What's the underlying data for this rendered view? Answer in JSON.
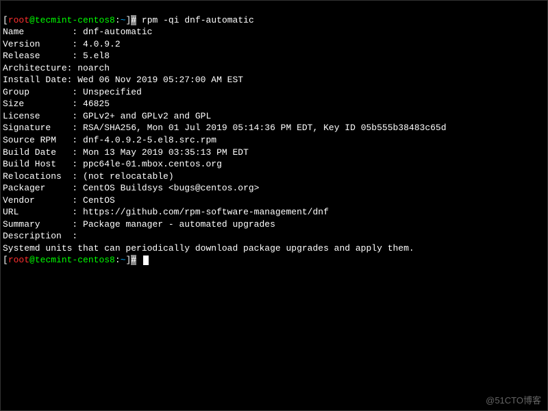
{
  "prompt": {
    "bracket_open": "[",
    "user": "root",
    "at": "@",
    "host": "tecmint-centos8",
    "colon": ":",
    "path": "~",
    "bracket_close": "]",
    "hash": "#"
  },
  "command": " rpm -qi dnf-automatic",
  "fields": {
    "name": {
      "label": "Name        ",
      "sep": " : ",
      "value": "dnf-automatic"
    },
    "version": {
      "label": "Version     ",
      "sep": " : ",
      "value": "4.0.9.2"
    },
    "release": {
      "label": "Release     ",
      "sep": " : ",
      "value": "5.el8"
    },
    "arch": {
      "label": "Architecture",
      "sep": ": ",
      "value": "noarch"
    },
    "install": {
      "label": "Install Date",
      "sep": ": ",
      "value": "Wed 06 Nov 2019 05:27:00 AM EST"
    },
    "group": {
      "label": "Group       ",
      "sep": " : ",
      "value": "Unspecified"
    },
    "size": {
      "label": "Size        ",
      "sep": " : ",
      "value": "46825"
    },
    "license": {
      "label": "License     ",
      "sep": " : ",
      "value": "GPLv2+ and GPLv2 and GPL"
    },
    "signature": {
      "label": "Signature   ",
      "sep": " : ",
      "value": "RSA/SHA256, Mon 01 Jul 2019 05:14:36 PM EDT, Key ID 05b555b38483c65d"
    },
    "sourcerpm": {
      "label": "Source RPM  ",
      "sep": " : ",
      "value": "dnf-4.0.9.2-5.el8.src.rpm"
    },
    "builddate": {
      "label": "Build Date  ",
      "sep": " : ",
      "value": "Mon 13 May 2019 03:35:13 PM EDT"
    },
    "buildhost": {
      "label": "Build Host  ",
      "sep": " : ",
      "value": "ppc64le-01.mbox.centos.org"
    },
    "relocations": {
      "label": "Relocations ",
      "sep": " : ",
      "value": "(not relocatable)"
    },
    "packager": {
      "label": "Packager    ",
      "sep": " : ",
      "value": "CentOS Buildsys <bugs@centos.org>"
    },
    "vendor": {
      "label": "Vendor      ",
      "sep": " : ",
      "value": "CentOS"
    },
    "url": {
      "label": "URL         ",
      "sep": " : ",
      "value": "https://github.com/rpm-software-management/dnf"
    },
    "summary": {
      "label": "Summary     ",
      "sep": " : ",
      "value": "Package manager - automated upgrades"
    },
    "description": {
      "label": "Description ",
      "sep": " :",
      "value": ""
    }
  },
  "description_body": "Systemd units that can periodically download package upgrades and apply them.",
  "watermark": "@51CTO博客"
}
